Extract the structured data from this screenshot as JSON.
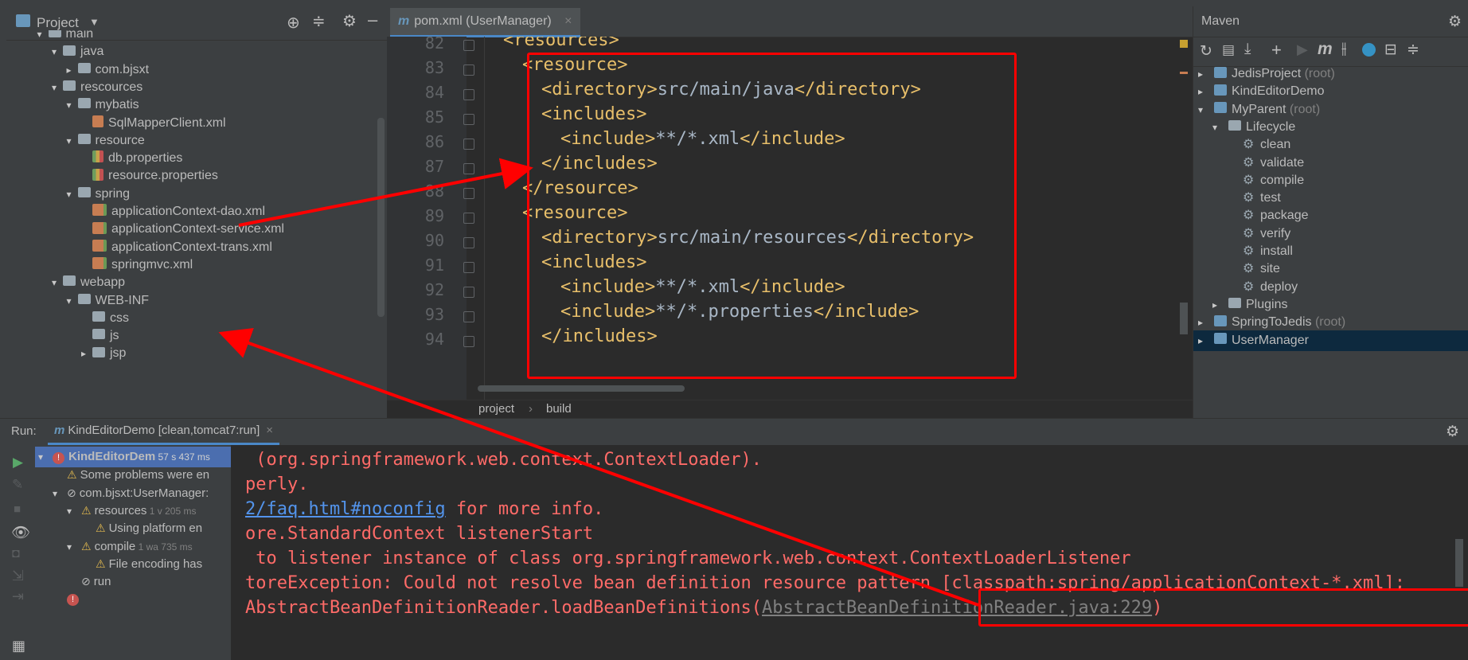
{
  "project_panel": {
    "title": "Project",
    "tree": [
      {
        "label": "main",
        "depth": 1,
        "arrow": "▾",
        "icon": "folder"
      },
      {
        "label": "java",
        "depth": 2,
        "arrow": "▾",
        "icon": "folder"
      },
      {
        "label": "com.bjsxt",
        "depth": 3,
        "arrow": "▸",
        "icon": "folder"
      },
      {
        "label": "rescources",
        "depth": 2,
        "arrow": "▾",
        "icon": "folder"
      },
      {
        "label": "mybatis",
        "depth": 3,
        "arrow": "▾",
        "icon": "folder"
      },
      {
        "label": "SqlMapperClient.xml",
        "depth": 4,
        "arrow": "",
        "icon": "xml"
      },
      {
        "label": "resource",
        "depth": 3,
        "arrow": "▾",
        "icon": "folder"
      },
      {
        "label": "db.properties",
        "depth": 4,
        "arrow": "",
        "icon": "prop"
      },
      {
        "label": "resource.properties",
        "depth": 4,
        "arrow": "",
        "icon": "prop"
      },
      {
        "label": "spring",
        "depth": 3,
        "arrow": "▾",
        "icon": "folder"
      },
      {
        "label": "applicationContext-dao.xml",
        "depth": 4,
        "arrow": "",
        "icon": "spring"
      },
      {
        "label": "applicationContext-service.xml",
        "depth": 4,
        "arrow": "",
        "icon": "spring"
      },
      {
        "label": "applicationContext-trans.xml",
        "depth": 4,
        "arrow": "",
        "icon": "spring"
      },
      {
        "label": "springmvc.xml",
        "depth": 4,
        "arrow": "",
        "icon": "spring"
      },
      {
        "label": "webapp",
        "depth": 2,
        "arrow": "▾",
        "icon": "folder"
      },
      {
        "label": "WEB-INF",
        "depth": 3,
        "arrow": "▾",
        "icon": "folder"
      },
      {
        "label": "css",
        "depth": 4,
        "arrow": "",
        "icon": "folder"
      },
      {
        "label": "js",
        "depth": 4,
        "arrow": "",
        "icon": "folder"
      },
      {
        "label": "jsp",
        "depth": 4,
        "arrow": "▸",
        "icon": "folder"
      }
    ]
  },
  "editor": {
    "tab_label": "pom.xml (UserManager)",
    "lines": [
      {
        "n": "82",
        "indent": 1,
        "parts": [
          [
            "tag",
            "<resources>"
          ]
        ]
      },
      {
        "n": "83",
        "indent": 2,
        "parts": [
          [
            "tag",
            "<resource>"
          ]
        ]
      },
      {
        "n": "84",
        "indent": 3,
        "parts": [
          [
            "tag",
            "<directory>"
          ],
          [
            "txt",
            "src/main/java"
          ],
          [
            "tag",
            "</directory>"
          ]
        ]
      },
      {
        "n": "85",
        "indent": 3,
        "parts": [
          [
            "tag",
            "<includes>"
          ]
        ]
      },
      {
        "n": "86",
        "indent": 4,
        "parts": [
          [
            "tag",
            "<include>"
          ],
          [
            "txt",
            "**/*.xml"
          ],
          [
            "tag",
            "</include>"
          ]
        ]
      },
      {
        "n": "87",
        "indent": 3,
        "parts": [
          [
            "tag",
            "</includes>"
          ]
        ]
      },
      {
        "n": "88",
        "indent": 2,
        "parts": [
          [
            "tag",
            "</resource>"
          ]
        ]
      },
      {
        "n": "89",
        "indent": 2,
        "parts": [
          [
            "tag",
            "<resource>"
          ]
        ]
      },
      {
        "n": "90",
        "indent": 3,
        "parts": [
          [
            "tag",
            "<directory>"
          ],
          [
            "txt",
            "src/main/resources"
          ],
          [
            "tag",
            "</directory>"
          ]
        ]
      },
      {
        "n": "91",
        "indent": 3,
        "parts": [
          [
            "tag",
            "<includes>"
          ]
        ]
      },
      {
        "n": "92",
        "indent": 4,
        "parts": [
          [
            "tag",
            "<include>"
          ],
          [
            "txt",
            "**/*.xml"
          ],
          [
            "tag",
            "</include>"
          ]
        ]
      },
      {
        "n": "93",
        "indent": 4,
        "parts": [
          [
            "tag",
            "<include>"
          ],
          [
            "txt",
            "**/*.properties"
          ],
          [
            "tag",
            "</include>"
          ]
        ]
      },
      {
        "n": "94",
        "indent": 3,
        "parts": [
          [
            "tag",
            "</includes>"
          ]
        ]
      }
    ],
    "breadcrumb": [
      "project",
      "build"
    ]
  },
  "maven_panel": {
    "title": "Maven",
    "tree": [
      {
        "label": "JedisProject",
        "suffix": "(root)",
        "depth": 0,
        "arrow": "▸",
        "icon": "mvn"
      },
      {
        "label": "KindEditorDemo",
        "suffix": "",
        "depth": 0,
        "arrow": "▸",
        "icon": "mvn"
      },
      {
        "label": "MyParent",
        "suffix": "(root)",
        "depth": 0,
        "arrow": "▾",
        "icon": "mvn"
      },
      {
        "label": "Lifecycle",
        "suffix": "",
        "depth": 1,
        "arrow": "▾",
        "icon": "folder"
      },
      {
        "label": "clean",
        "suffix": "",
        "depth": 2,
        "arrow": "",
        "icon": "gear"
      },
      {
        "label": "validate",
        "suffix": "",
        "depth": 2,
        "arrow": "",
        "icon": "gear"
      },
      {
        "label": "compile",
        "suffix": "",
        "depth": 2,
        "arrow": "",
        "icon": "gear"
      },
      {
        "label": "test",
        "suffix": "",
        "depth": 2,
        "arrow": "",
        "icon": "gear"
      },
      {
        "label": "package",
        "suffix": "",
        "depth": 2,
        "arrow": "",
        "icon": "gear"
      },
      {
        "label": "verify",
        "suffix": "",
        "depth": 2,
        "arrow": "",
        "icon": "gear"
      },
      {
        "label": "install",
        "suffix": "",
        "depth": 2,
        "arrow": "",
        "icon": "gear"
      },
      {
        "label": "site",
        "suffix": "",
        "depth": 2,
        "arrow": "",
        "icon": "gear"
      },
      {
        "label": "deploy",
        "suffix": "",
        "depth": 2,
        "arrow": "",
        "icon": "gear"
      },
      {
        "label": "Plugins",
        "suffix": "",
        "depth": 1,
        "arrow": "▸",
        "icon": "folder"
      },
      {
        "label": "SpringToJedis",
        "suffix": "(root)",
        "depth": 0,
        "arrow": "▸",
        "icon": "mvn"
      },
      {
        "label": "UserManager",
        "suffix": "",
        "depth": 0,
        "arrow": "▸",
        "icon": "mvn",
        "selected": true
      }
    ]
  },
  "run_panel": {
    "label": "Run:",
    "tab_label": "KindEditorDemo [clean,tomcat7:run]",
    "tree": [
      {
        "label": "KindEditorDem",
        "time": "57 s 437 ms",
        "depth": 0,
        "arrow": "▾",
        "icon": "err",
        "selected": true
      },
      {
        "label": "Some problems were en",
        "time": "",
        "depth": 1,
        "arrow": "",
        "icon": "warn"
      },
      {
        "label": "com.bjsxt:UserManager:",
        "time": "",
        "depth": 1,
        "arrow": "▾",
        "icon": "skip"
      },
      {
        "label": "resources",
        "time": "1 v 205 ms",
        "depth": 2,
        "arrow": "▾",
        "icon": "warn"
      },
      {
        "label": "Using platform en",
        "time": "",
        "depth": 3,
        "arrow": "",
        "icon": "warn"
      },
      {
        "label": "compile",
        "time": "1 wa 735 ms",
        "depth": 2,
        "arrow": "▾",
        "icon": "warn"
      },
      {
        "label": "File encoding has",
        "time": "",
        "depth": 3,
        "arrow": "",
        "icon": "warn"
      },
      {
        "label": "run",
        "time": "",
        "depth": 2,
        "arrow": "",
        "icon": "skip"
      },
      {
        "label": "",
        "time": "",
        "depth": 1,
        "arrow": "",
        "icon": "err-only"
      }
    ],
    "console": {
      "l1": " (org.springframework.web.context.ContextLoader).",
      "l2": "perly.",
      "l3_link": "2/faq.html#noconfig",
      "l3_rest": " for more info.",
      "l4": "ore.StandardContext listenerStart",
      "l5": " to listener instance of class org.springframework.web.context.ContextLoaderListener",
      "l6_pre": "toreException: Could not resolve bean definition resource pattern ",
      "l6_box": "[classpath:spring/applicationContext-*.xml];",
      "l7_pre": "AbstractBeanDefinitionReader.loadBeanDefinitions(",
      "l7_link": "AbstractBeanDefinitionReader.java:229",
      "l7_post": ")"
    }
  },
  "colors": {
    "annotation": "#ff0000",
    "tag": "#e8bf6a",
    "error_text": "#ff6b68",
    "link": "#5394ec"
  }
}
